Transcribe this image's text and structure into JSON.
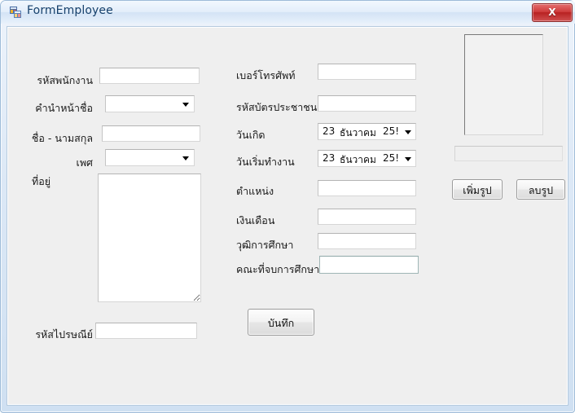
{
  "window": {
    "title": "FormEmployee",
    "icon": "form-icon",
    "close_label": "X",
    "ghost_lines": [
      "",
      "",
      "",
      ""
    ]
  },
  "left_column": {
    "fields": [
      {
        "label": "รหัสพนักงาน",
        "type": "textbox",
        "value": "",
        "name": "employee-id"
      },
      {
        "label": "คำนำหน้าชื่อ",
        "type": "combobox",
        "value": "",
        "name": "title-prefix"
      },
      {
        "label": "ชื่อ - นามสกุล",
        "type": "textbox",
        "value": "",
        "name": "full-name"
      },
      {
        "label": "เพศ",
        "type": "combobox",
        "value": "",
        "name": "gender"
      },
      {
        "label": "ที่อยู่",
        "type": "multiline",
        "value": "",
        "name": "address"
      },
      {
        "label": "รหัสไปรษณีย์",
        "type": "textbox",
        "value": "",
        "name": "postal-code"
      }
    ]
  },
  "middle_column": {
    "fields": [
      {
        "label": "เบอร์โทรศัพท์",
        "type": "textbox",
        "value": "",
        "name": "phone-number"
      },
      {
        "label": "รหัสบัตรประชาชน",
        "type": "textbox",
        "value": "",
        "name": "national-id"
      },
      {
        "label": "วันเกิด",
        "type": "datepicker",
        "name": "birth-date",
        "day": "23",
        "month": "ธันวาคม",
        "year": "25!"
      },
      {
        "label": "วันเริ่มทำงาน",
        "type": "datepicker",
        "name": "start-work-date",
        "day": "23",
        "month": "ธันวาคม",
        "year": "25!"
      },
      {
        "label": "ตำแหน่ง",
        "type": "textbox",
        "value": "",
        "name": "position"
      },
      {
        "label": "เงินเดือน",
        "type": "textbox",
        "value": "",
        "name": "salary"
      },
      {
        "label": "วุฒิการศึกษา",
        "type": "textbox",
        "value": "",
        "name": "education-level"
      },
      {
        "label": "คณะที่จบการศึกษา",
        "type": "textbox",
        "value": "",
        "name": "faculty-graduated",
        "focused": true
      }
    ]
  },
  "right_panel": {
    "picture_box_name": "employee-photo",
    "photo_path_value": "",
    "buttons": [
      {
        "label": "เพิ่มรูป",
        "name": "add-photo-button"
      },
      {
        "label": "ลบรูป",
        "name": "delete-photo-button"
      }
    ]
  },
  "actions": {
    "save_label": "บันทึก"
  },
  "colors": {
    "form_background": "#efefef",
    "window_frame": "#cfe0f2",
    "title_text": "#15406b",
    "close_button": "#cf3d3d",
    "field_border": "#d6d6d6",
    "focused_border": "#9fb6b6"
  }
}
